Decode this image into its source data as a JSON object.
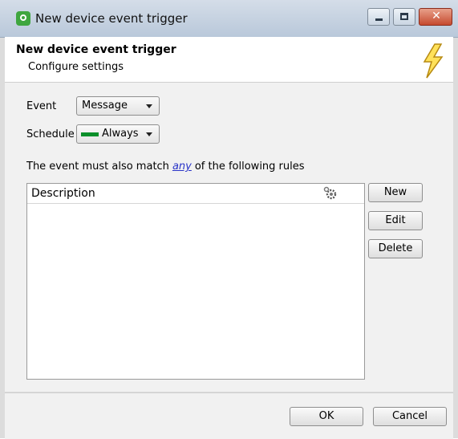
{
  "window": {
    "title": "New device event trigger"
  },
  "header": {
    "title": "New device event trigger",
    "subtitle": "Configure settings"
  },
  "form": {
    "event_label": "Event",
    "event_value": "Message",
    "schedule_label": "Schedule",
    "schedule_value": "Always",
    "schedule_color": "#0a8f2a"
  },
  "rules": {
    "prefix": "The event must also match",
    "match_link": "any",
    "suffix": "of the following rules",
    "column_header": "Description",
    "rows": []
  },
  "side_buttons": {
    "new": "New",
    "edit": "Edit",
    "delete": "Delete"
  },
  "footer": {
    "ok": "OK",
    "cancel": "Cancel"
  },
  "icons": {
    "app": "app-icon",
    "bolt": "lightning-bolt-icon",
    "gear": "gear-icon",
    "cursor": "mouse-pointer-icon"
  }
}
